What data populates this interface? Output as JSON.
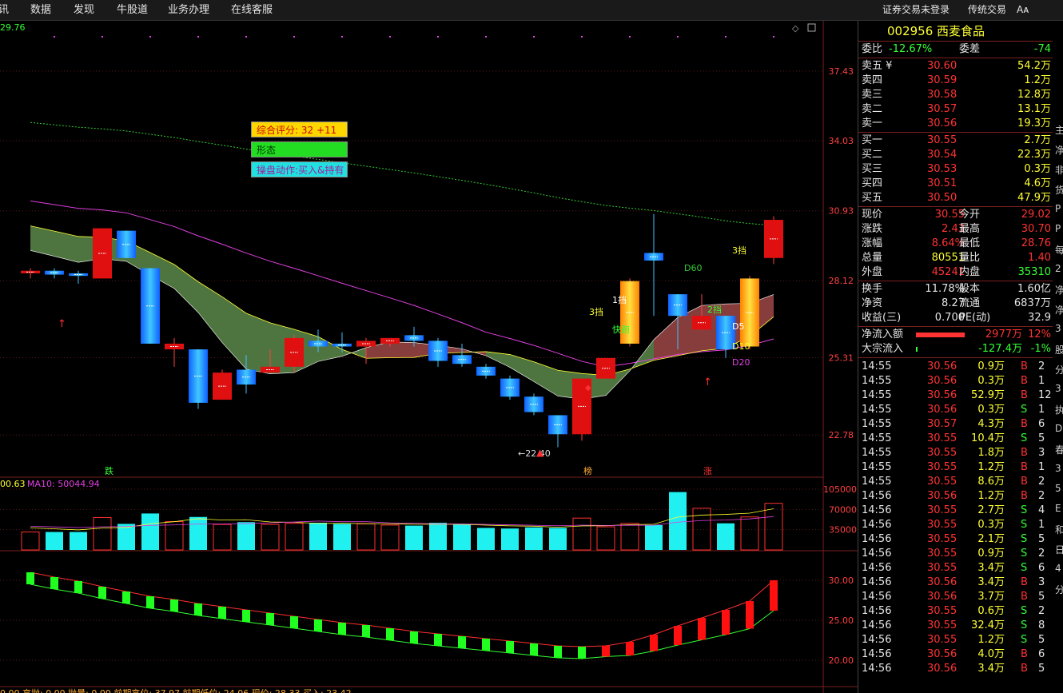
{
  "menu": {
    "items": [
      "讯",
      "数据",
      "发现",
      "牛股道",
      "业务办理",
      "在线客服"
    ],
    "right_items": [
      "证券交易未登录",
      "传统交易",
      "Aᴀ"
    ]
  },
  "stock": {
    "code": "002956",
    "name": "西麦食品"
  },
  "order_book": {
    "weibi_label": "委比",
    "weibi": "-12.67%",
    "weicha_label": "委差",
    "weicha": "-74",
    "asks": [
      {
        "label": "卖五 ¥",
        "price": "30.60",
        "vol": "54.2万"
      },
      {
        "label": "卖四",
        "price": "30.59",
        "vol": "1.2万"
      },
      {
        "label": "卖三",
        "price": "30.58",
        "vol": "12.8万"
      },
      {
        "label": "卖二",
        "price": "30.57",
        "vol": "13.1万"
      },
      {
        "label": "卖一",
        "price": "30.56",
        "vol": "19.3万"
      }
    ],
    "bids": [
      {
        "label": "买一",
        "price": "30.55",
        "vol": "2.7万"
      },
      {
        "label": "买二",
        "price": "30.54",
        "vol": "22.3万"
      },
      {
        "label": "买三",
        "price": "30.53",
        "vol": "0.3万"
      },
      {
        "label": "买四",
        "price": "30.51",
        "vol": "4.6万"
      },
      {
        "label": "买五",
        "price": "30.50",
        "vol": "47.9万"
      }
    ]
  },
  "quote": [
    {
      "l1": "现价",
      "v1": "30.55",
      "c1": "red",
      "l2": "今开",
      "v2": "29.02",
      "c2": "red"
    },
    {
      "l1": "涨跌",
      "v1": "2.43",
      "c1": "red",
      "l2": "最高",
      "v2": "30.70",
      "c2": "red"
    },
    {
      "l1": "涨幅",
      "v1": "8.64%",
      "c1": "red",
      "l2": "最低",
      "v2": "28.76",
      "c2": "red"
    },
    {
      "l1": "总量",
      "v1": "80551",
      "c1": "yellow",
      "l2": "量比",
      "v2": "1.40",
      "c2": "red"
    },
    {
      "l1": "外盘",
      "v1": "45241",
      "c1": "red",
      "l2": "内盘",
      "v2": "35310",
      "c2": "green"
    }
  ],
  "fundamentals": [
    {
      "l1": "换手",
      "v1": "11.78%",
      "l2": "股本",
      "v2": "1.60亿"
    },
    {
      "l1": "净资",
      "v1": "8.27",
      "l2": "流通",
      "v2": "6837万"
    },
    {
      "l1": "收益(三)",
      "v1": "0.700",
      "l2": "PE(动)",
      "v2": "32.9"
    }
  ],
  "flows": [
    {
      "label": "净流入额",
      "value": "2977万",
      "pct": "12%",
      "bar_fraction": 0.95,
      "color": "#ff3333"
    },
    {
      "label": "大宗流入",
      "value": "-127.4万",
      "pct": "-1%",
      "bar_fraction": 0.03,
      "color": "#33ff33"
    }
  ],
  "tape": [
    [
      "14:55",
      "30.56",
      "0.9万",
      "B",
      "2"
    ],
    [
      "14:55",
      "30.56",
      "0.3万",
      "B",
      "1"
    ],
    [
      "14:55",
      "30.56",
      "52.9万",
      "B",
      "12"
    ],
    [
      "14:55",
      "30.56",
      "0.3万",
      "S",
      "1"
    ],
    [
      "14:55",
      "30.57",
      "4.3万",
      "B",
      "6"
    ],
    [
      "14:55",
      "30.55",
      "10.4万",
      "S",
      "5"
    ],
    [
      "14:55",
      "30.55",
      "1.8万",
      "B",
      "3"
    ],
    [
      "14:55",
      "30.55",
      "1.2万",
      "B",
      "1"
    ],
    [
      "14:55",
      "30.55",
      "8.6万",
      "B",
      "2"
    ],
    [
      "14:56",
      "30.56",
      "1.2万",
      "B",
      "2"
    ],
    [
      "14:56",
      "30.55",
      "2.7万",
      "S",
      "4"
    ],
    [
      "14:56",
      "30.55",
      "0.3万",
      "S",
      "1"
    ],
    [
      "14:56",
      "30.55",
      "2.1万",
      "S",
      "5"
    ],
    [
      "14:56",
      "30.55",
      "0.9万",
      "S",
      "2"
    ],
    [
      "14:56",
      "30.55",
      "3.4万",
      "S",
      "6"
    ],
    [
      "14:56",
      "30.56",
      "3.4万",
      "B",
      "3"
    ],
    [
      "14:56",
      "30.56",
      "3.7万",
      "B",
      "5"
    ],
    [
      "14:56",
      "30.55",
      "0.6万",
      "S",
      "2"
    ],
    [
      "14:56",
      "30.55",
      "32.4万",
      "S",
      "8"
    ],
    [
      "14:56",
      "30.55",
      "1.2万",
      "S",
      "5"
    ],
    [
      "14:56",
      "30.56",
      "4.0万",
      "B",
      "6"
    ],
    [
      "14:56",
      "30.56",
      "3.4万",
      "B",
      "5"
    ]
  ],
  "sidestrip": [
    "主",
    "净",
    "非",
    "货",
    "P",
    "P",
    "每",
    "2",
    "净",
    "净",
    "3",
    "股",
    "分",
    "3",
    "执",
    "D",
    "春",
    "3",
    "5",
    "E",
    "和",
    "日",
    "4",
    "分"
  ],
  "price_axis": [
    "37.43",
    "34.03",
    "30.93",
    "28.12",
    "25.31",
    "22.78"
  ],
  "price_top_label": "29.76",
  "volume_axis": [
    "105000",
    "70000",
    "35000"
  ],
  "volume_legend": {
    "ma5": "00.63",
    "ma10_label": "MA10: 50044.94"
  },
  "indicator_axis": [
    "30.00",
    "25.00",
    "20.00"
  ],
  "bottom_legend": "0.00  高抛: 0.00  抛量: 0.00  前期高位: 37.97  前期低位: 24.06          现价: 28.33  买入: 23.42",
  "info_boxes": [
    {
      "text": "综合评分: 32    +11",
      "bg": "#ffd700",
      "fg": "#cc0000"
    },
    {
      "text": "形态",
      "bg": "#22dd22",
      "fg": "#003300"
    },
    {
      "text": "操盘动作:买入&持有",
      "bg": "#20e0e0",
      "fg": "#a020a0"
    }
  ],
  "chart_labels": {
    "low_marker": "←22.40",
    "d60": "D60",
    "d5": "D5",
    "d10": "D10",
    "d20": "D20",
    "die": "跌",
    "bang": "榜",
    "zhang": "涨",
    "dang3a": "3挡",
    "dang3b": "3挡",
    "dang2": "2挡",
    "dang1": "1挡",
    "kuaipao": "快跑"
  },
  "chart_data": {
    "type": "candlestick",
    "candles": [
      {
        "o": 28.4,
        "c": 28.5,
        "h": 28.6,
        "l": 28.2
      },
      {
        "o": 28.5,
        "c": 28.35,
        "h": 28.6,
        "l": 28.2
      },
      {
        "o": 28.4,
        "c": 28.3,
        "h": 28.5,
        "l": 28.0
      },
      {
        "o": 28.2,
        "c": 30.2,
        "h": 30.2,
        "l": 28.2
      },
      {
        "o": 30.1,
        "c": 29.0,
        "h": 30.1,
        "l": 29.0
      },
      {
        "o": 28.6,
        "c": 25.8,
        "h": 28.6,
        "l": 25.8
      },
      {
        "o": 25.6,
        "c": 25.8,
        "h": 26.0,
        "l": 25.0
      },
      {
        "o": 25.6,
        "c": 23.8,
        "h": 25.6,
        "l": 23.6
      },
      {
        "o": 23.9,
        "c": 24.8,
        "h": 24.9,
        "l": 23.9
      },
      {
        "o": 24.9,
        "c": 24.4,
        "h": 25.4,
        "l": 24.1
      },
      {
        "o": 24.8,
        "c": 25.0,
        "h": 25.6,
        "l": 24.8
      },
      {
        "o": 25.0,
        "c": 26.0,
        "h": 26.1,
        "l": 24.8
      },
      {
        "o": 25.9,
        "c": 25.7,
        "h": 26.3,
        "l": 25.5
      },
      {
        "o": 25.8,
        "c": 25.7,
        "h": 26.2,
        "l": 25.5
      },
      {
        "o": 25.7,
        "c": 25.9,
        "h": 26.0,
        "l": 25.1
      },
      {
        "o": 25.8,
        "c": 26.0,
        "h": 26.0,
        "l": 25.7
      },
      {
        "o": 26.1,
        "c": 25.9,
        "h": 26.4,
        "l": 25.7
      },
      {
        "o": 25.9,
        "c": 25.2,
        "h": 26.0,
        "l": 25.0
      },
      {
        "o": 25.4,
        "c": 25.1,
        "h": 25.8,
        "l": 25.0
      },
      {
        "o": 25.0,
        "c": 24.7,
        "h": 25.1,
        "l": 24.6
      },
      {
        "o": 24.6,
        "c": 24.0,
        "h": 24.7,
        "l": 23.9
      },
      {
        "o": 24.0,
        "c": 23.5,
        "h": 24.1,
        "l": 23.4
      },
      {
        "o": 23.4,
        "c": 22.8,
        "h": 23.4,
        "l": 22.4
      },
      {
        "o": 22.8,
        "c": 24.6,
        "h": 24.6,
        "l": 22.6
      },
      {
        "o": 24.6,
        "c": 25.3,
        "h": 25.3,
        "l": 24.6
      },
      {
        "o": 25.8,
        "c": 28.1,
        "h": 28.2,
        "l": 25.7
      },
      {
        "o": 29.2,
        "c": 28.9,
        "h": 30.8,
        "l": 26.8
      },
      {
        "o": 27.6,
        "c": 26.8,
        "h": 27.6,
        "l": 25.6
      },
      {
        "o": 26.3,
        "c": 26.8,
        "h": 27.6,
        "l": 26.3
      },
      {
        "o": 26.8,
        "c": 25.6,
        "h": 26.8,
        "l": 25.3
      },
      {
        "o": 25.7,
        "c": 28.2,
        "h": 28.3,
        "l": 25.6
      },
      {
        "o": 29.0,
        "c": 30.55,
        "h": 30.7,
        "l": 28.76
      }
    ],
    "volumes": [
      31000,
      31000,
      31000,
      56000,
      45000,
      63000,
      49000,
      57000,
      44000,
      48000,
      44000,
      46000,
      47000,
      45000,
      45000,
      43000,
      42000,
      47000,
      44000,
      38000,
      37000,
      39000,
      38000,
      55000,
      40000,
      46000,
      43000,
      100000,
      72000,
      46000,
      57000,
      80551
    ],
    "indicator": [
      31.0,
      30.4,
      29.9,
      29.2,
      28.6,
      28.0,
      27.6,
      27.1,
      26.7,
      26.3,
      25.9,
      25.5,
      25.1,
      24.7,
      24.4,
      24.0,
      23.6,
      23.3,
      23.0,
      22.7,
      22.4,
      22.1,
      21.8,
      21.7,
      21.8,
      22.3,
      23.2,
      24.3,
      25.3,
      26.3,
      27.4,
      30.0
    ]
  }
}
